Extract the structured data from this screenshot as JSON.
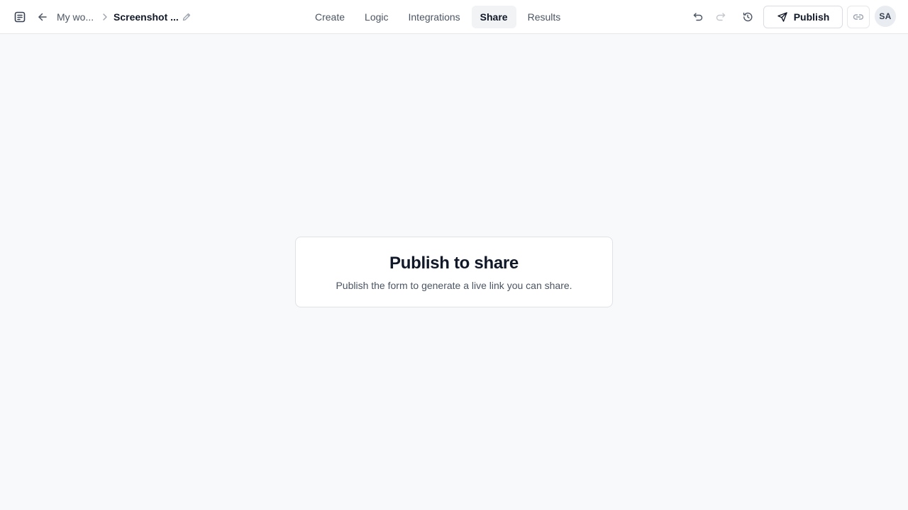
{
  "header": {
    "breadcrumb": {
      "parent": "My wo...",
      "current": "Screenshot ..."
    },
    "tabs": [
      {
        "label": "Create",
        "active": false
      },
      {
        "label": "Logic",
        "active": false
      },
      {
        "label": "Integrations",
        "active": false
      },
      {
        "label": "Share",
        "active": true
      },
      {
        "label": "Results",
        "active": false
      }
    ],
    "publish_label": "Publish",
    "avatar_initials": "SA"
  },
  "main": {
    "card": {
      "title": "Publish to share",
      "subtitle": "Publish the form to generate a live link you can share."
    }
  },
  "icons": [
    "form-logo-icon",
    "back-arrow-icon",
    "chevron-right-icon",
    "pencil-icon",
    "undo-icon",
    "redo-icon",
    "history-icon",
    "send-icon",
    "link-icon"
  ],
  "colors": {
    "background": "#f8f9fb",
    "active_tab_bg": "#f1f3f5",
    "text_primary": "#111827",
    "text_secondary": "#4b5563"
  }
}
